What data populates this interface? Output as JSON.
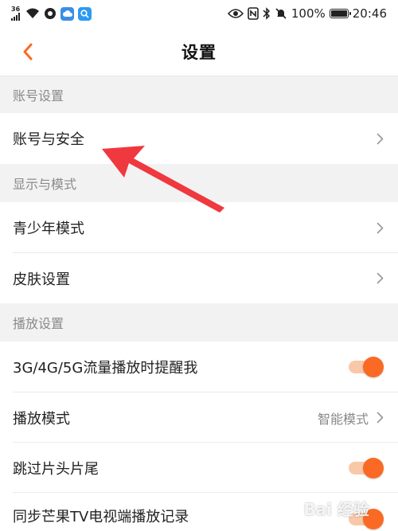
{
  "status_bar": {
    "network": "36",
    "battery": "100%",
    "time": "20:46"
  },
  "nav": {
    "title": "设置"
  },
  "sections": {
    "account": {
      "header": "账号设置",
      "items": {
        "account_security": "账号与安全"
      }
    },
    "display": {
      "header": "显示与模式",
      "items": {
        "youth_mode": "青少年模式",
        "skin": "皮肤设置"
      }
    },
    "playback": {
      "header": "播放设置",
      "items": {
        "cellular_reminder": {
          "label": "3G/4G/5G流量播放时提醒我",
          "on": true
        },
        "play_mode": {
          "label": "播放模式",
          "value": "智能模式"
        },
        "skip_intro": {
          "label": "跳过片头片尾",
          "on": true
        },
        "sync_tv": {
          "label": "同步芒果TV电视端播放记录",
          "on": true
        }
      }
    }
  },
  "watermark": "Bai 经验",
  "colors": {
    "accent": "#fb6a24",
    "annotation_arrow": "#f0383f",
    "background": "#f2f2f2"
  }
}
